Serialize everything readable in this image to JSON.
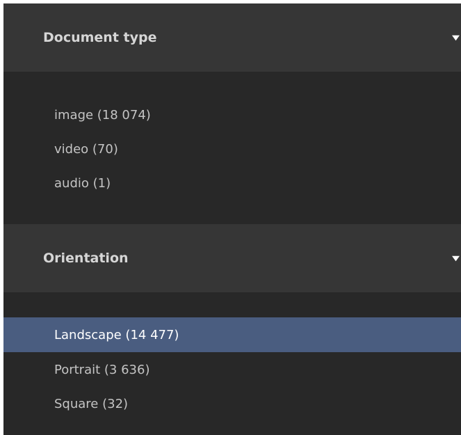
{
  "filters": {
    "document_type": {
      "title": "Document type",
      "caret_icon": "caret-down-icon",
      "items": [
        {
          "label": "image (18 074)",
          "selected": false
        },
        {
          "label": "video (70)",
          "selected": false
        },
        {
          "label": "audio (1)",
          "selected": false
        }
      ]
    },
    "orientation": {
      "title": "Orientation",
      "caret_icon": "caret-down-icon",
      "items": [
        {
          "label": "Landscape (14 477)",
          "selected": true
        },
        {
          "label": "Portrait (3 636)",
          "selected": false
        },
        {
          "label": "Square (32)",
          "selected": false
        }
      ]
    }
  },
  "colors": {
    "panel_bg": "#282828",
    "header_bg": "#363636",
    "selected_bg": "#4a5d80",
    "text": "#c4c4c4",
    "header_text": "#d6d6d6"
  }
}
